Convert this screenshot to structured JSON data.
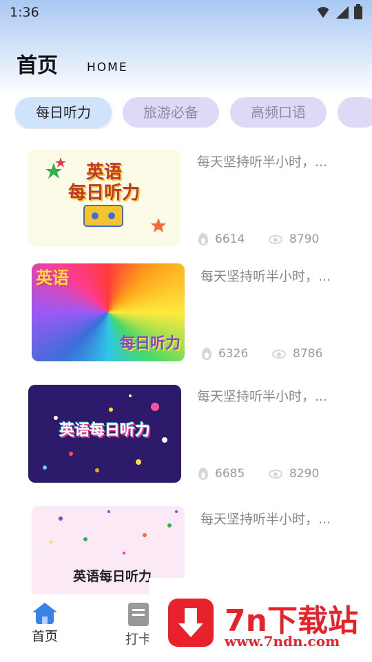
{
  "status_bar": {
    "time": "1:36"
  },
  "header": {
    "title": "首页",
    "subtitle": "HOME"
  },
  "tabs": [
    {
      "label": "每日听力",
      "active": true
    },
    {
      "label": "旅游必备",
      "active": false
    },
    {
      "label": "高频口语",
      "active": false
    },
    {
      "label": "",
      "active": false
    }
  ],
  "list": [
    {
      "title": "每天坚持听半小时，...",
      "thumb_text": "英语\n每日听力",
      "likes": "6614",
      "views": "8790"
    },
    {
      "title": "每天坚持听半小时，...",
      "thumb_text_top": "英语",
      "thumb_text_bottom": "每日听力",
      "likes": "6326",
      "views": "8786"
    },
    {
      "title": "每天坚持听半小时，...",
      "thumb_text": "英语每日听力",
      "likes": "6685",
      "views": "8290"
    },
    {
      "title": "每天坚持听半小时，...",
      "thumb_text": "英语每日听力"
    }
  ],
  "bottom_nav": [
    {
      "label": "首页",
      "icon": "home-icon",
      "active": true
    },
    {
      "label": "打卡",
      "icon": "card-icon",
      "active": false
    }
  ],
  "watermark": {
    "title": "7n下载站",
    "url": "www.7ndn.com"
  },
  "colors": {
    "accent": "#3b82e6",
    "watermark": "#e8222a"
  }
}
